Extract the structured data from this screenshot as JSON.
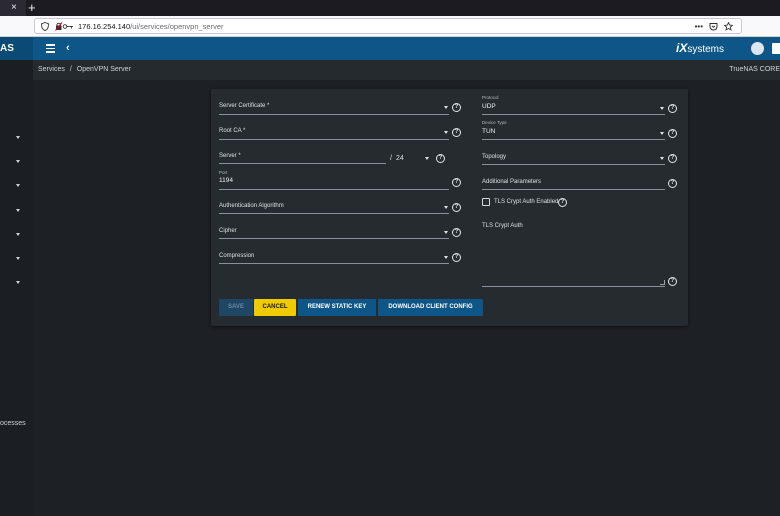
{
  "browser": {
    "tab_close": "×",
    "new_tab": "+",
    "url_host": "176.16.254.140",
    "url_path": "/ui/services/openvpn_server",
    "url_icons": [
      "more-icon",
      "pocket-icon",
      "star-icon"
    ]
  },
  "header": {
    "brand_fragment": "AS",
    "logo_text": "iX",
    "logo_suffix": "systems"
  },
  "breadcrumb": {
    "items": [
      "Services",
      "OpenVPN Server"
    ],
    "separator": "/",
    "product": "TrueNAS CORE"
  },
  "sidebar": {
    "partial_text": "ocesses"
  },
  "form": {
    "server_certificate": {
      "label": "Server Certificate *",
      "value": ""
    },
    "root_ca": {
      "label": "Root CA *",
      "value": ""
    },
    "server": {
      "label": "Server *",
      "value": "",
      "netmask_sep": "/",
      "netmask": "24"
    },
    "port": {
      "label": "Port",
      "value": "1194"
    },
    "auth_algorithm": {
      "label": "Authentication Algorithm",
      "value": ""
    },
    "cipher": {
      "label": "Cipher",
      "value": ""
    },
    "compression": {
      "label": "Compression",
      "value": ""
    },
    "protocol": {
      "label": "Protocol",
      "value": "UDP"
    },
    "device_type": {
      "label": "Device Type",
      "value": "TUN"
    },
    "topology": {
      "label": "Topology",
      "value": ""
    },
    "additional_parameters": {
      "label": "Additional Parameters",
      "value": ""
    },
    "tls_crypt_auth_enabled": {
      "label": "TLS Crypt Auth Enabled",
      "checked": false
    },
    "tls_crypt_auth": {
      "label": "TLS Crypt Auth",
      "value": ""
    },
    "help_glyph": "?"
  },
  "buttons": {
    "save": "SAVE",
    "cancel": "CANCEL",
    "renew": "RENEW STATIC KEY",
    "download": "DOWNLOAD CLIENT CONFIG"
  },
  "colors": {
    "header_blue": "#0d5687",
    "cancel_yellow": "#f0cb00",
    "card_bg": "#262b30",
    "page_bg": "#1d2024"
  }
}
